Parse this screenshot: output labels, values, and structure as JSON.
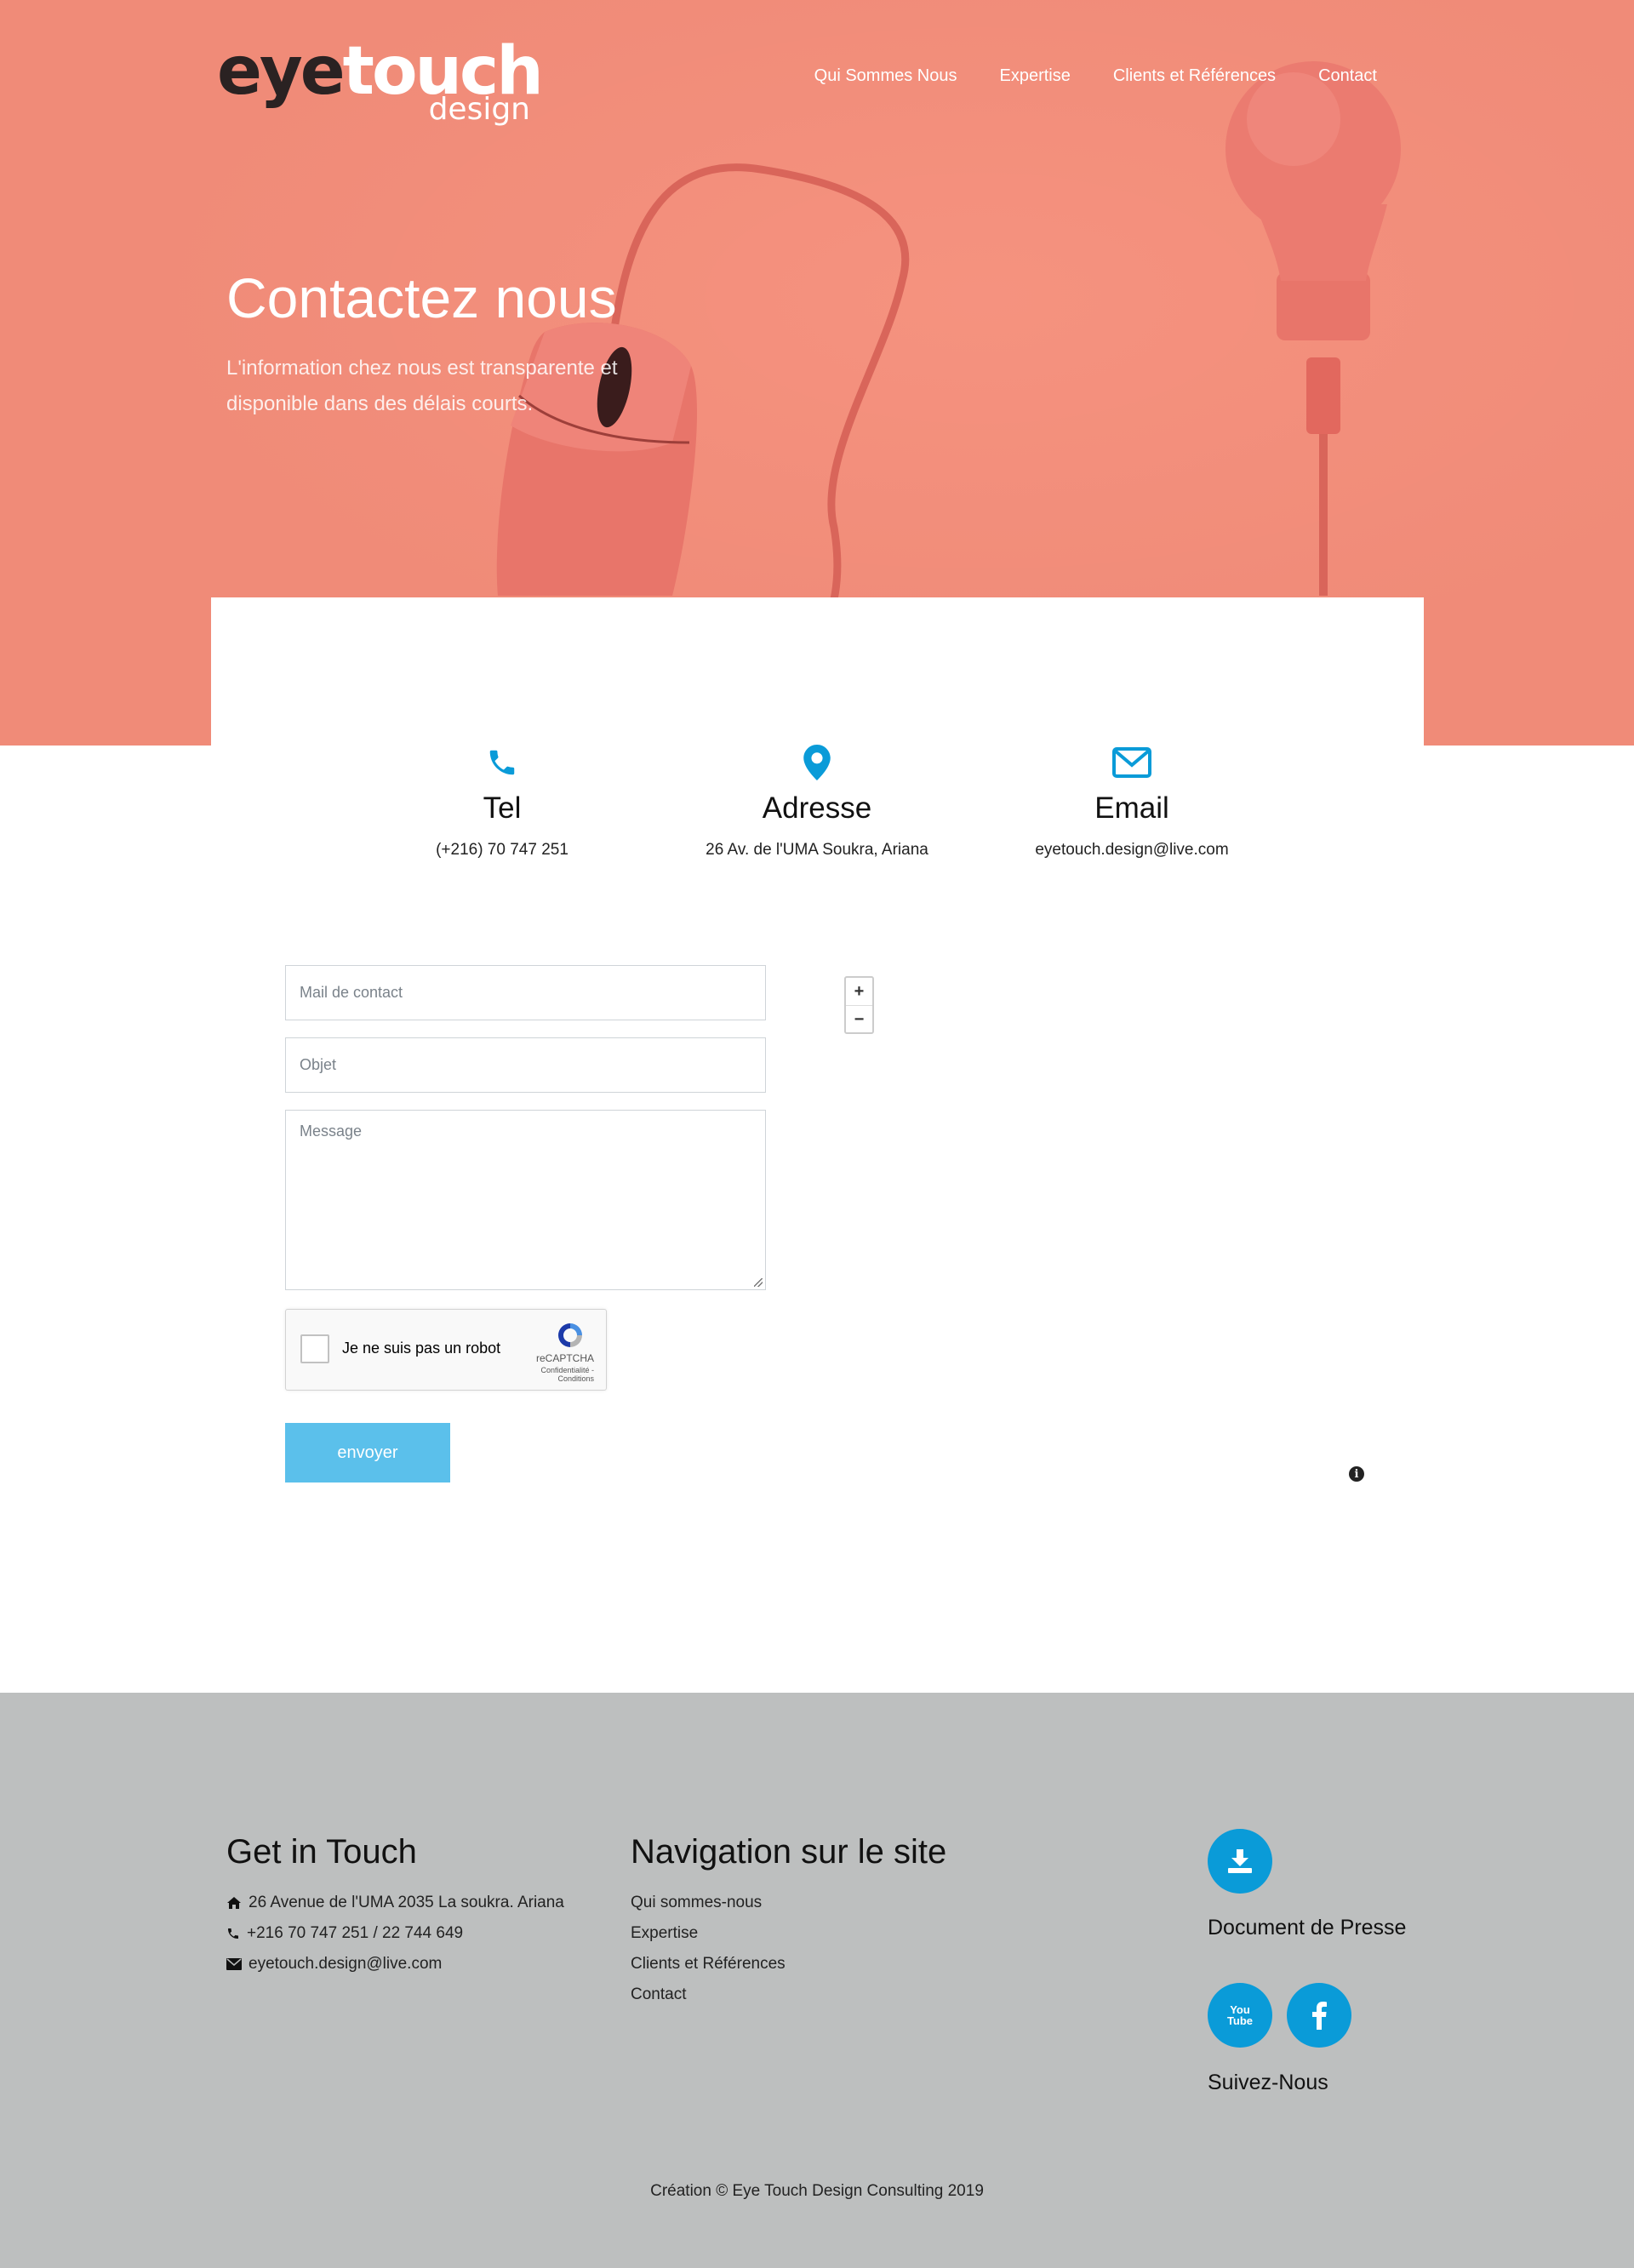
{
  "header": {
    "logo_eye": "eye",
    "logo_touch": "touch",
    "logo_sub": "design",
    "nav": [
      "Qui Sommes Nous",
      "Expertise",
      "Clients et Références",
      "Contact"
    ]
  },
  "hero": {
    "title": "Contactez nous",
    "subtitle": "L'information chez nous est transparente et disponible dans des délais courts."
  },
  "contact_info": [
    {
      "icon": "phone-icon",
      "title": "Tel",
      "value": "(+216) 70 747 251"
    },
    {
      "icon": "map-marker-icon",
      "title": "Adresse",
      "value": "26 Av. de l'UMA Soukra, Ariana"
    },
    {
      "icon": "envelope-icon",
      "title": "Email",
      "value": "eyetouch.design@live.com"
    }
  ],
  "form": {
    "email_placeholder": "Mail de contact",
    "subject_placeholder": "Objet",
    "message_placeholder": "Message",
    "captcha_label": "Je ne suis pas un robot",
    "captcha_brand": "reCAPTCHA",
    "captcha_terms": "Confidentialité - Conditions",
    "submit_label": "envoyer"
  },
  "map": {
    "zoom_in": "+",
    "zoom_out": "−",
    "info": "i"
  },
  "footer": {
    "get_in_touch": {
      "title": "Get in Touch",
      "address": "26 Avenue de l'UMA 2035 La soukra. Ariana",
      "phone": "+216 70 747 251 / 22 744 649",
      "email": "eyetouch.design@live.com"
    },
    "navigation": {
      "title": "Navigation sur le site",
      "links": [
        "Qui sommes-nous",
        "Expertise",
        "Clients et Références",
        "Contact"
      ]
    },
    "document_label": "Document de Presse",
    "social_label": "Suivez-Nous",
    "youtube_icon_text": "You\nTube",
    "copyright": "Création © Eye Touch Design Consulting 2019"
  },
  "colors": {
    "hero_bg": "#f08b78",
    "accent": "#0a9bd8",
    "button": "#5bc0eb",
    "footer_bg": "#bdbfbf"
  }
}
